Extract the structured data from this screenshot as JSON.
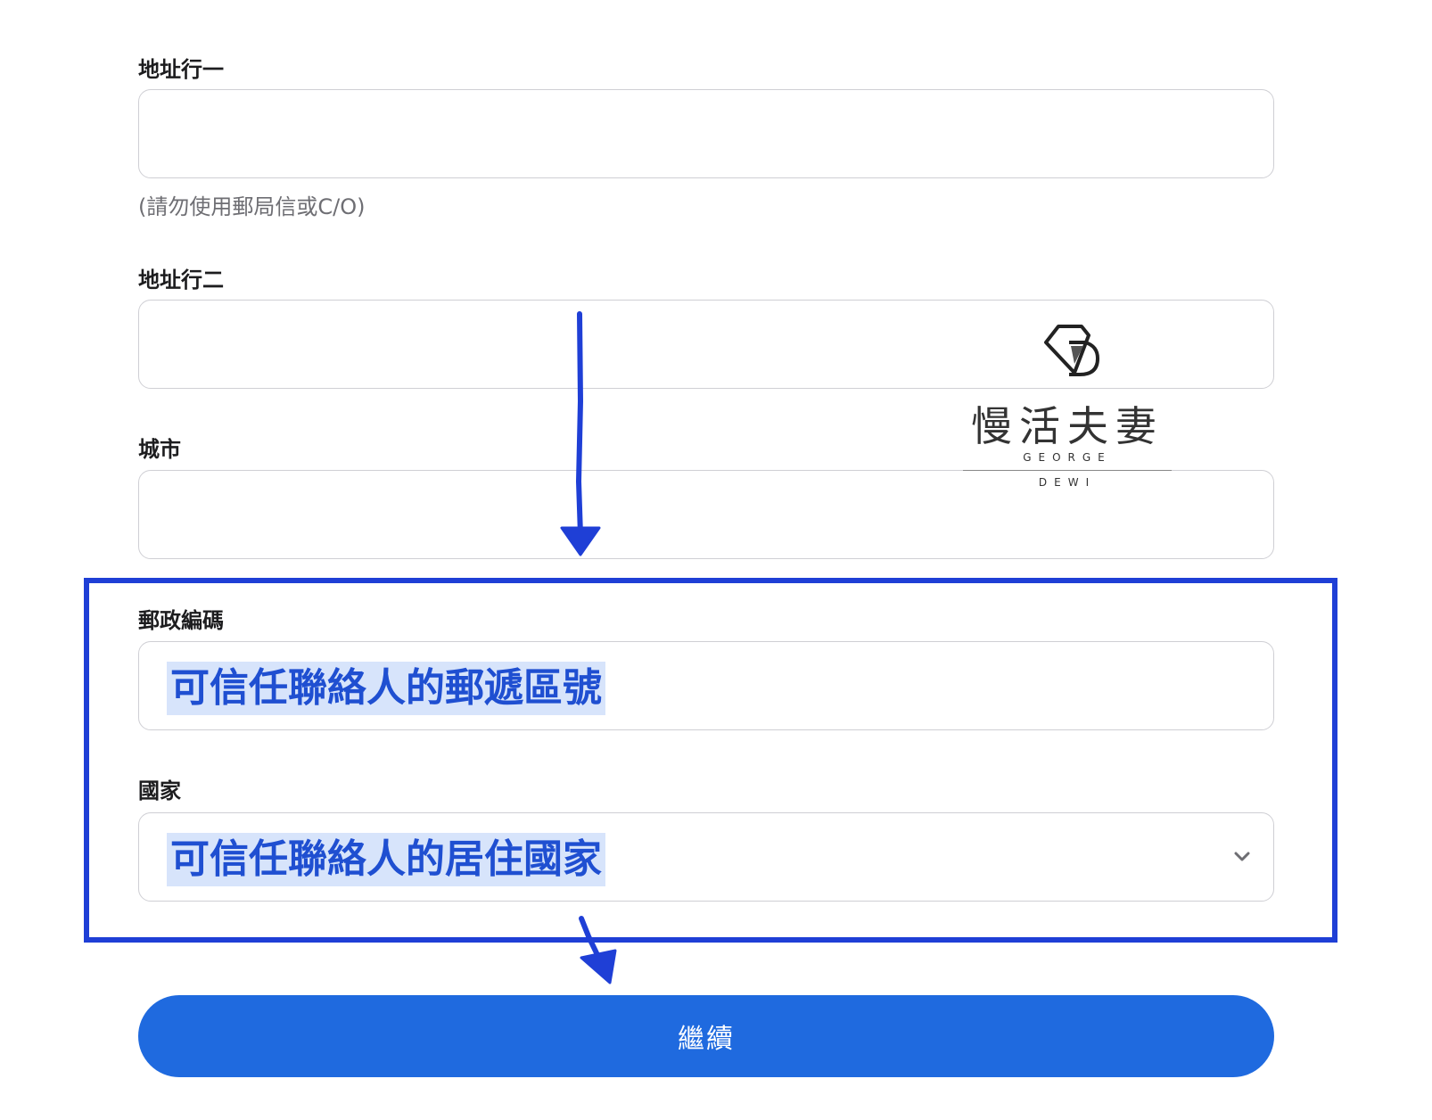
{
  "form": {
    "address_line1": {
      "label": "地址行一",
      "value": "",
      "hint": "(請勿使用郵局信或C/O)"
    },
    "address_line2": {
      "label": "地址行二",
      "value": ""
    },
    "city": {
      "label": "城市",
      "value": ""
    },
    "postal_code": {
      "label": "郵政編碼",
      "value": "可信任聯絡人的郵遞區號"
    },
    "country": {
      "label": "國家",
      "value": "可信任聯絡人的居住國家"
    },
    "continue_label": "繼續"
  },
  "watermark": {
    "brand": "慢活夫妻",
    "line1": "GEORGE",
    "line2": "DEWI"
  },
  "colors": {
    "accent": "#1f6adf",
    "annotation": "#1f3fd6",
    "highlight": "#d7e4fb",
    "border": "#cfcfd4"
  },
  "icons": [
    "chevron-down-icon",
    "diamond-logo-icon",
    "arrow-down-icon"
  ]
}
